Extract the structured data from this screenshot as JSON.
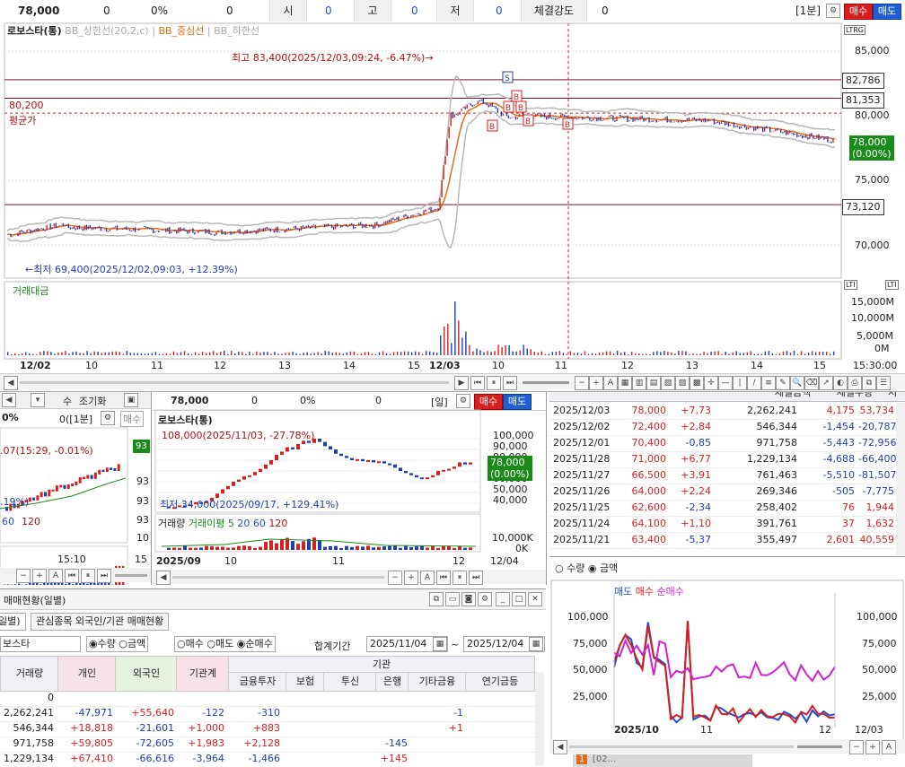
{
  "header": {
    "price": "78,000",
    "change": "0",
    "rate": "0%",
    "volume": "0",
    "open_label": "시",
    "open": "0",
    "high_label": "고",
    "high": "0",
    "low_label": "저",
    "low": "0",
    "strength_label": "체결강도",
    "strength": "0",
    "interval": "[1분]",
    "sell": "매수",
    "buy": "매도"
  },
  "main_chart": {
    "stock_name": "로보스타(통)",
    "bb_upper": "BB_상한선(20,2,c)",
    "bb_mid": "BB_중심선",
    "bb_lower": "BB_하한선",
    "high_note": "최고 83,400(2025/12/03,09:24, -6.47%)→",
    "low_note": "←최저 69,400(2025/12/02,09:03, +12.39%)",
    "avg_price": "80,200",
    "avg_label": "평균가",
    "price_axis": [
      "85,000",
      "80,000",
      "75,000",
      "70,000"
    ],
    "level_tags": [
      "82,786",
      "81,353",
      "73,120"
    ],
    "current": "78,000",
    "current_rate": "(0.00%)",
    "volume_title": "거래대금",
    "volume_axis": [
      "15,000M",
      "10,000M",
      "5,000M",
      "0M"
    ],
    "x_axis": [
      "12/02",
      "10",
      "11",
      "12",
      "13",
      "14",
      "15",
      "12/03",
      "10",
      "11",
      "12",
      "13",
      "14",
      "15"
    ],
    "time_readout": "15:30:00",
    "badges": [
      "S",
      "B",
      "B",
      "B",
      "B",
      "B",
      "B"
    ]
  },
  "left_mini": {
    "title_a": "수",
    "title_b": "조기화",
    "rate": "0%",
    "interval": "0([1분]",
    "sell": "매수",
    "note": ".07(15:29, -0.01%)",
    "note2": ".19%)",
    "ma60": "60",
    "ma120": "120",
    "time": "15:10",
    "axis_right": "15",
    "axis": [
      "93",
      "93",
      "93",
      "10"
    ],
    "tag": "93"
  },
  "daily_chart": {
    "price": "78,000",
    "change": "0",
    "rate": "0%",
    "volume": "0",
    "interval": "[일]",
    "sell": "매수",
    "buy": "매도",
    "stock_name": "로보스타(통)",
    "high_note": "108,000(2025/11/03, -27.78%)",
    "low_note": "최저 34,000(2025/09/17, +129.41%)",
    "price_axis": [
      "100,000",
      "90,000",
      "80,000",
      "70,000",
      "60,000",
      "50,000",
      "40,000"
    ],
    "current": "78,000",
    "current_rate": "(0.00%)",
    "vol_title": "거래량",
    "vol_ma": "거래이평",
    "ma5": "5",
    "ma20": "20",
    "ma60": "60",
    "ma120": "120",
    "vol_axis": [
      "10,000K",
      "0K"
    ],
    "x_axis": [
      "2025/09",
      "10",
      "11",
      "12",
      "12/04"
    ]
  },
  "daily_table": {
    "headers": [
      "",
      "",
      "",
      "체결금액",
      "체결수량",
      "저"
    ],
    "rows": [
      [
        "2025/12/03",
        "78,000",
        "+7,73",
        "2,262,241",
        "4,175",
        "53,734"
      ],
      [
        "2025/12/02",
        "72,400",
        "+2,84",
        "546,344",
        "-1,454",
        "-20,787"
      ],
      [
        "2025/12/01",
        "70,400",
        "-0,85",
        "971,758",
        "-5,443",
        "-72,956"
      ],
      [
        "2025/11/28",
        "71,000",
        "+6,77",
        "1,229,134",
        "-4,688",
        "-66,400"
      ],
      [
        "2025/11/27",
        "66,500",
        "+3,91",
        "761,463",
        "-5,510",
        "-81,507"
      ],
      [
        "2025/11/26",
        "64,000",
        "+2,24",
        "269,346",
        "-505",
        "-7,775"
      ],
      [
        "2025/11/25",
        "62,600",
        "-2,34",
        "258,402",
        "76",
        "1,944"
      ],
      [
        "2025/11/24",
        "64,100",
        "+1,10",
        "391,761",
        "37",
        "1,632"
      ],
      [
        "2025/11/21",
        "63,400",
        "-5,37",
        "355,497",
        "2,601",
        "40,559"
      ]
    ]
  },
  "flow_chart": {
    "opt_qty": "수량",
    "opt_amt": "금액",
    "legend": [
      "매도",
      "매수",
      "순매수"
    ],
    "axis": [
      "100,000",
      "75,000",
      "50,000",
      "25,000"
    ],
    "x_axis": [
      "2025/10",
      "11",
      "12",
      "12/03"
    ]
  },
  "trading": {
    "window_title": "매매현황(일별)",
    "tabs": [
      "일별)",
      "관심종목 외국인/기관 매매현황"
    ],
    "stock": "보스타",
    "opts": [
      "수량",
      "금액",
      "매수",
      "매도",
      "순매수"
    ],
    "period_label": "합계기간",
    "from": "2025/11/04",
    "to": "2025/12/04",
    "headers": [
      "거래량",
      "개인",
      "외국인",
      "기관계",
      "금융투자",
      "보험",
      "투신",
      "은행",
      "기타금융",
      "연기금등"
    ],
    "inst_label": "기관",
    "rows": [
      [
        "0",
        "",
        "",
        "",
        "",
        "",
        "",
        "",
        "",
        ""
      ],
      [
        "2,262,241",
        "-47,971",
        "+55,640",
        "-122",
        "-310",
        "",
        "",
        "",
        "-1",
        ""
      ],
      [
        "546,344",
        "+18,818",
        "-21,601",
        "+1,000",
        "+883",
        "",
        "",
        "",
        "+1",
        ""
      ],
      [
        "971,758",
        "+59,805",
        "-72,605",
        "+1,983",
        "+2,128",
        "",
        "",
        "-145",
        "",
        ""
      ],
      [
        "1,229,134",
        "+67,410",
        "-66,616",
        "-3,964",
        "-1,466",
        "",
        "",
        "+145",
        "",
        ""
      ]
    ]
  },
  "taskbar": {
    "num": "1",
    "label": "[02..."
  }
}
